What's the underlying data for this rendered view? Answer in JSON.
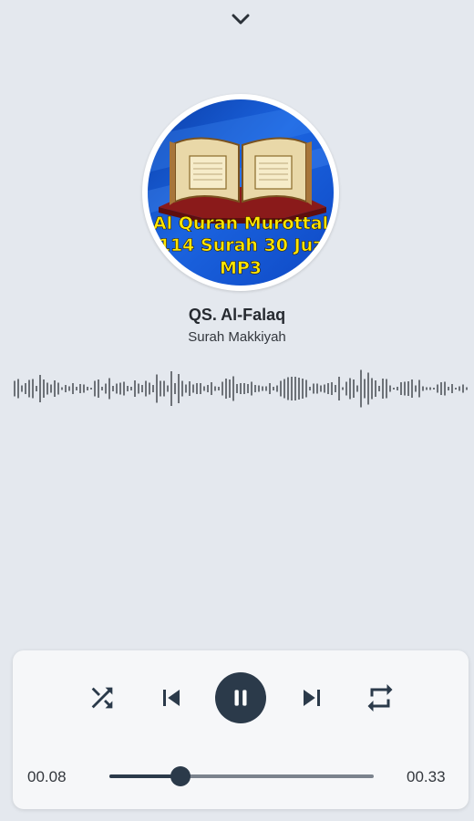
{
  "header": {
    "collapse_icon": "chevron-down-icon"
  },
  "cover": {
    "line1": "Al Quran Murottal",
    "line2": "114 Surah 30 Juz",
    "line3": "MP3",
    "image": "quran-book-illustration"
  },
  "track": {
    "title": "QS. Al-Falaq",
    "subtitle": "Surah Makkiyah"
  },
  "controls": {
    "shuffle_icon": "shuffle-icon",
    "previous_icon": "skip-previous-icon",
    "play_state_icon": "pause-icon",
    "next_icon": "skip-next-icon",
    "repeat_icon": "repeat-icon"
  },
  "progress": {
    "elapsed": "00.08",
    "total": "00.33",
    "fraction": 0.27
  },
  "colors": {
    "background": "#e4e8ee",
    "accent": "#2b3a4a",
    "cover_text": "#ffe600",
    "cover_blue": "#1b64e0"
  }
}
